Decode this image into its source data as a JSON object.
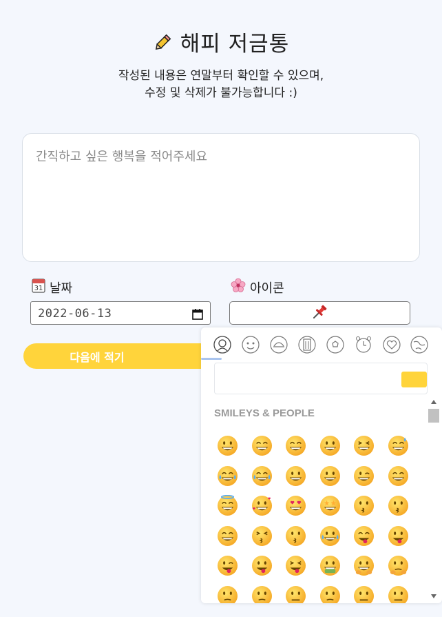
{
  "header": {
    "title": "해피 저금통",
    "icon": "pencil-icon",
    "subtitle_line1": "작성된 내용은 연말부터 확인할 수 있으며,",
    "subtitle_line2": "수정 및 삭제가 불가능합니다 :)"
  },
  "memo": {
    "placeholder": "간직하고 싶은 행복을 적어주세요"
  },
  "date_field": {
    "label": "날짜",
    "icon": "calendar-icon",
    "value": "2022-06-13"
  },
  "icon_field": {
    "label": "아이콘",
    "icon": "cherry-blossom-icon",
    "selected_icon": "pushpin-icon"
  },
  "next_button": {
    "label": "다음에 적기",
    "color": "#ffd43b"
  },
  "emoji_picker": {
    "categories": [
      "smileys-people",
      "animals-nature",
      "food-drink",
      "travel-places",
      "activities",
      "objects",
      "symbols",
      "flags"
    ],
    "active_category": "smileys-people",
    "section_title": "SMILEYS & PEOPLE",
    "emoji_rows": [
      [
        "grinning",
        "smiley",
        "smile",
        "grin",
        "laughing",
        "sweat-smile"
      ],
      [
        "rolling-on-floor",
        "joy",
        "slightly-smiling",
        "upside-down",
        "wink",
        "blush"
      ],
      [
        "innocent",
        "smiling-hearts",
        "heart-eyes",
        "star-struck",
        "kissing-heart",
        "kissing"
      ],
      [
        "relaxed",
        "kissing-closed-eyes",
        "kissing-smiling-eyes",
        "smiling-tear",
        "yum",
        "tongue"
      ],
      [
        "winking-tongue",
        "zany",
        "squinting-tongue",
        "money-mouth",
        "hugging",
        "hand-over-mouth"
      ],
      [
        "shushing",
        "thinking",
        "zipper-mouth",
        "raised-eyebrow",
        "neutral",
        "expressionless"
      ]
    ],
    "accent_color": "#ffd43b"
  }
}
